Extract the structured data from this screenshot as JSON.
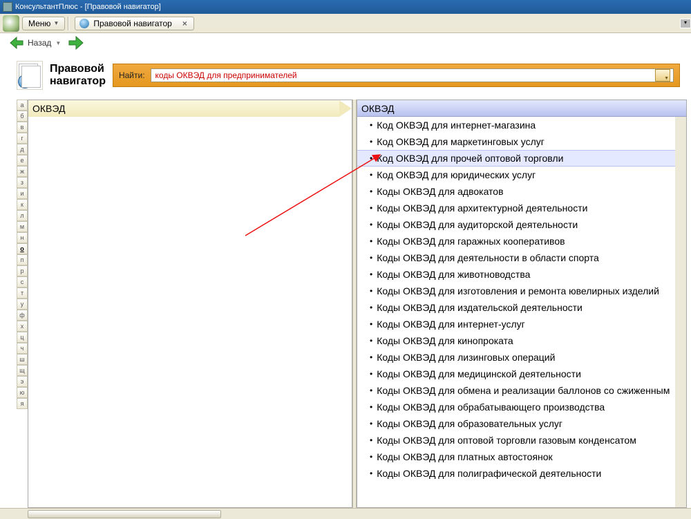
{
  "window": {
    "title": "КонсультантПлюс - [Правовой навигатор]"
  },
  "menubar": {
    "menu_label": "Меню"
  },
  "tab": {
    "label": "Правовой навигатор"
  },
  "nav": {
    "back_label": "Назад"
  },
  "header": {
    "title_line1": "Правовой",
    "title_line2": "навигатор"
  },
  "search": {
    "label": "Найти:",
    "value": "коды ОКВЭД для предпринимателей"
  },
  "alpha": [
    "а",
    "б",
    "в",
    "г",
    "д",
    "е",
    "ж",
    "з",
    "и",
    "к",
    "л",
    "м",
    "н",
    "о",
    "п",
    "р",
    "с",
    "т",
    "у",
    "ф",
    "х",
    "ц",
    "ч",
    "ш",
    "щ",
    "э",
    "ю",
    "я"
  ],
  "alpha_active": "о",
  "left": {
    "title": "ОКВЭД"
  },
  "right": {
    "title": "ОКВЭД",
    "selected_index": 2,
    "items": [
      "Код ОКВЭД для интернет-магазина",
      "Код ОКВЭД для маркетинговых услуг",
      "Код ОКВЭД для прочей оптовой торговли",
      "Код ОКВЭД для юридических услуг",
      "Коды ОКВЭД для адвокатов",
      "Коды ОКВЭД для архитектурной деятельности",
      "Коды ОКВЭД для аудиторской деятельности",
      "Коды ОКВЭД для гаражных кооперативов",
      "Коды ОКВЭД для деятельности в области спорта",
      "Коды ОКВЭД для животноводства",
      "Коды ОКВЭД для изготовления и ремонта ювелирных изделий",
      "Коды ОКВЭД для издательской деятельности",
      "Коды ОКВЭД для интернет-услуг",
      "Коды ОКВЭД для кинопроката",
      "Коды ОКВЭД для лизинговых операций",
      "Коды ОКВЭД для медицинской деятельности",
      "Коды ОКВЭД для обмена и реализации баллонов со сжиженным",
      "Коды ОКВЭД для обрабатывающего производства",
      "Коды ОКВЭД для образовательных услуг",
      "Коды ОКВЭД для оптовой торговли газовым конденсатом",
      "Коды ОКВЭД для платных автостоянок",
      "Коды ОКВЭД для полиграфической деятельности"
    ]
  }
}
